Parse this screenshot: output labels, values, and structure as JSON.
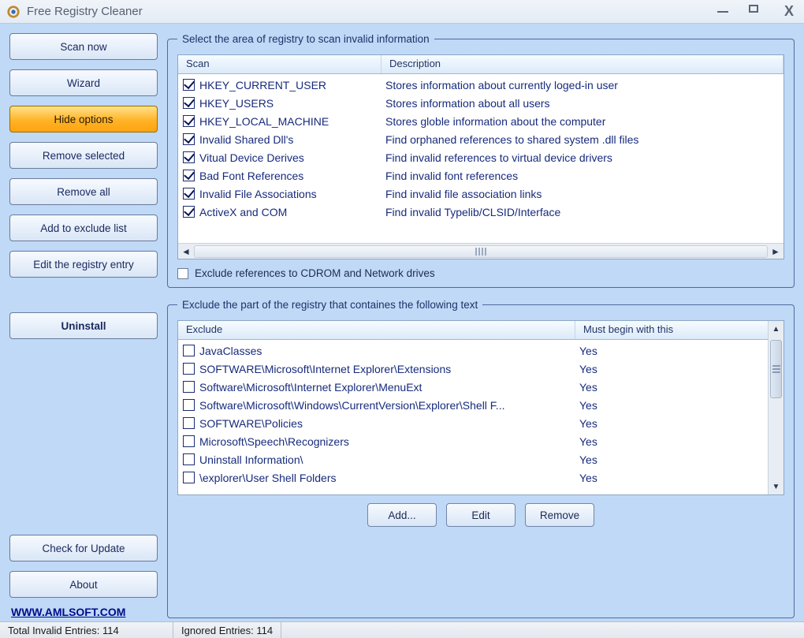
{
  "window": {
    "title": "Free Registry Cleaner"
  },
  "sidebar": {
    "scan_now": "Scan now",
    "wizard": "Wizard",
    "hide_options": "Hide options",
    "remove_selected": "Remove selected",
    "remove_all": "Remove all",
    "add_exclude": "Add to exclude list",
    "edit_registry": "Edit the registry entry",
    "uninstall": "Uninstall",
    "check_update": "Check for Update",
    "about": "About"
  },
  "homelink": "WWW.AMLSOFT.COM",
  "scan_area": {
    "legend": "Select the area of registry to scan invalid information",
    "col_scan": "Scan",
    "col_desc": "Description",
    "rows": [
      {
        "name": "HKEY_CURRENT_USER",
        "desc": "Stores information about currently loged-in user"
      },
      {
        "name": "HKEY_USERS",
        "desc": "Stores information about all users"
      },
      {
        "name": "HKEY_LOCAL_MACHINE",
        "desc": "Stores globle information about the computer"
      },
      {
        "name": "Invalid Shared Dll's",
        "desc": "Find orphaned references to shared system .dll files"
      },
      {
        "name": "Vitual Device Derives",
        "desc": "Find invalid references to virtual device drivers"
      },
      {
        "name": "Bad Font References",
        "desc": "Find invalid font references"
      },
      {
        "name": "Invalid File Associations",
        "desc": "Find invalid file association links"
      },
      {
        "name": "ActiveX and COM",
        "desc": "Find invalid Typelib/CLSID/Interface"
      }
    ],
    "exclude_cdrom": "Exclude references to CDROM and Network drives"
  },
  "exclude_area": {
    "legend": "Exclude the part of the registry that containes the following text",
    "col_exclude": "Exclude",
    "col_begin": "Must begin with this",
    "rows": [
      {
        "path": "JavaClasses",
        "begin": "Yes"
      },
      {
        "path": "SOFTWARE\\Microsoft\\Internet Explorer\\Extensions",
        "begin": "Yes"
      },
      {
        "path": "Software\\Microsoft\\Internet Explorer\\MenuExt",
        "begin": "Yes"
      },
      {
        "path": "Software\\Microsoft\\Windows\\CurrentVersion\\Explorer\\Shell F...",
        "begin": "Yes"
      },
      {
        "path": "SOFTWARE\\Policies",
        "begin": "Yes"
      },
      {
        "path": "Microsoft\\Speech\\Recognizers",
        "begin": "Yes"
      },
      {
        "path": "Uninstall Information\\",
        "begin": "Yes"
      },
      {
        "path": "\\explorer\\User Shell Folders",
        "begin": "Yes"
      }
    ],
    "btn_add": "Add...",
    "btn_edit": "Edit",
    "btn_remove": "Remove"
  },
  "status": {
    "total_label": "Total Invalid Entries:",
    "total_value": "114",
    "ignored_label": "Ignored Entries:",
    "ignored_value": "114"
  }
}
